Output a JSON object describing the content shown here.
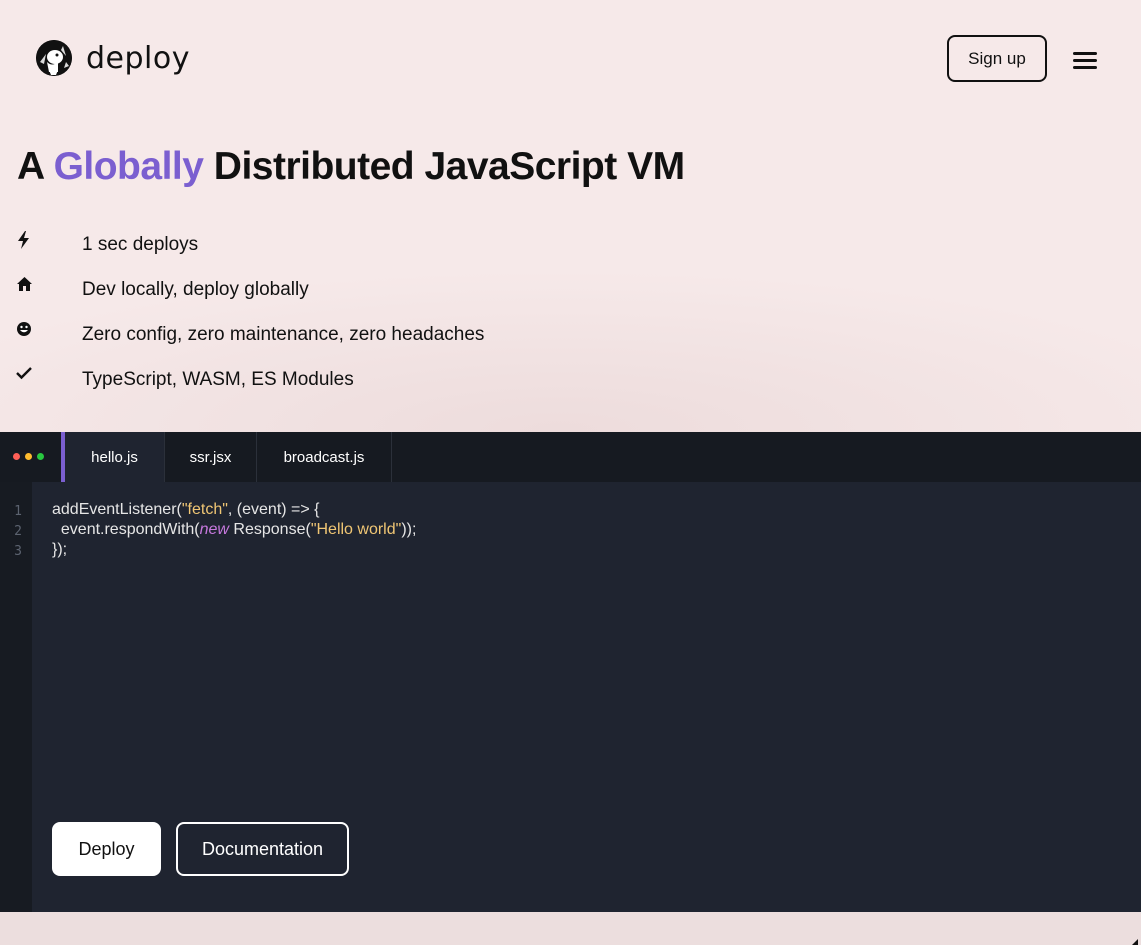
{
  "header": {
    "logo_text": "deploy",
    "signup_label": "Sign up",
    "menu_icon": "hamburger-menu-icon"
  },
  "hero": {
    "title_prefix": "A",
    "title_accent": "Globally",
    "title_suffix": "Distributed JavaScript VM",
    "accent_color": "#7b5fd0"
  },
  "features": [
    {
      "icon": "lightning-icon",
      "text": "1 sec deploys"
    },
    {
      "icon": "home-icon",
      "text": "Dev locally, deploy globally"
    },
    {
      "icon": "smiley-icon",
      "text": "Zero config, zero maintenance, zero headaches"
    },
    {
      "icon": "checkmark-icon",
      "text": "TypeScript, WASM, ES Modules"
    }
  ],
  "editor": {
    "tabs": [
      {
        "label": "hello.js",
        "active": true
      },
      {
        "label": "ssr.jsx",
        "active": false
      },
      {
        "label": "broadcast.js",
        "active": false
      }
    ],
    "line_numbers": [
      "1",
      "2",
      "3"
    ],
    "code": {
      "l1_a": "addEventListener(",
      "l1_str": "\"fetch\"",
      "l1_b": ", (event) => {",
      "l2_a": "  event.respondWith(",
      "l2_kw": "new",
      "l2_b": " Response(",
      "l2_str": "\"Hello world\"",
      "l2_c": "));",
      "l3": "});"
    },
    "deploy_label": "Deploy",
    "docs_label": "Documentation",
    "window_dot_colors": [
      "#ff5f57",
      "#febc2e",
      "#28c840"
    ]
  }
}
